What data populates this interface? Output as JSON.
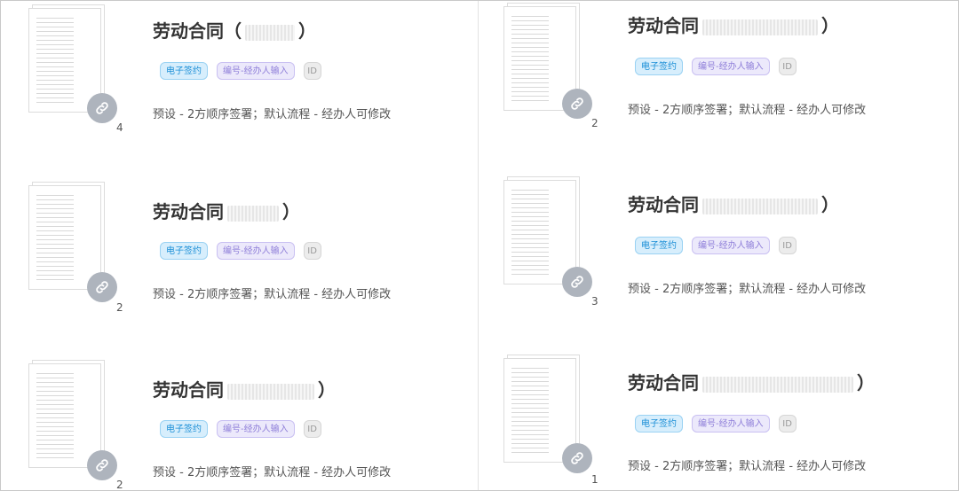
{
  "cards": [
    {
      "title": "劳动合同（",
      "title_tail": "）",
      "tags": [
        "电子签约",
        "编号-经办人输入",
        "ID"
      ],
      "description": "预设 - 2方顺序签署；默认流程 - 经办人可修改",
      "page_count": "4"
    },
    {
      "title": "劳动合同",
      "title_tail": "）",
      "tags": [
        "电子签约",
        "编号-经办人输入",
        "ID"
      ],
      "description": "预设 - 2方顺序签署；默认流程 - 经办人可修改",
      "page_count": "2"
    },
    {
      "title": "劳动合同",
      "title_tail": "）",
      "tags": [
        "电子签约",
        "编号-经办人输入",
        "ID"
      ],
      "description": "预设 - 2方顺序签署；默认流程 - 经办人可修改",
      "page_count": "2"
    },
    {
      "title": "劳动合同",
      "title_tail": "）",
      "tags": [
        "电子签约",
        "编号-经办人输入",
        "ID"
      ],
      "description": "预设 - 2方顺序签署；默认流程 - 经办人可修改",
      "page_count": "2"
    },
    {
      "title": "劳动合同",
      "title_tail": "）",
      "tags": [
        "电子签约",
        "编号-经办人输入",
        "ID"
      ],
      "description": "预设 - 2方顺序签署；默认流程 - 经办人可修改",
      "page_count": "3"
    },
    {
      "title": "劳动合同",
      "title_tail": "）",
      "tags": [
        "电子签约",
        "编号-经办人输入",
        "ID"
      ],
      "description": "预设 - 2方顺序签署；默认流程 - 经办人可修改",
      "page_count": "1"
    }
  ],
  "icons": {
    "link_badge": "link-icon"
  },
  "colors": {
    "tag_esign": "#1a8ed6",
    "tag_number": "#8f7fd9",
    "badge": "#aeb4bd"
  }
}
